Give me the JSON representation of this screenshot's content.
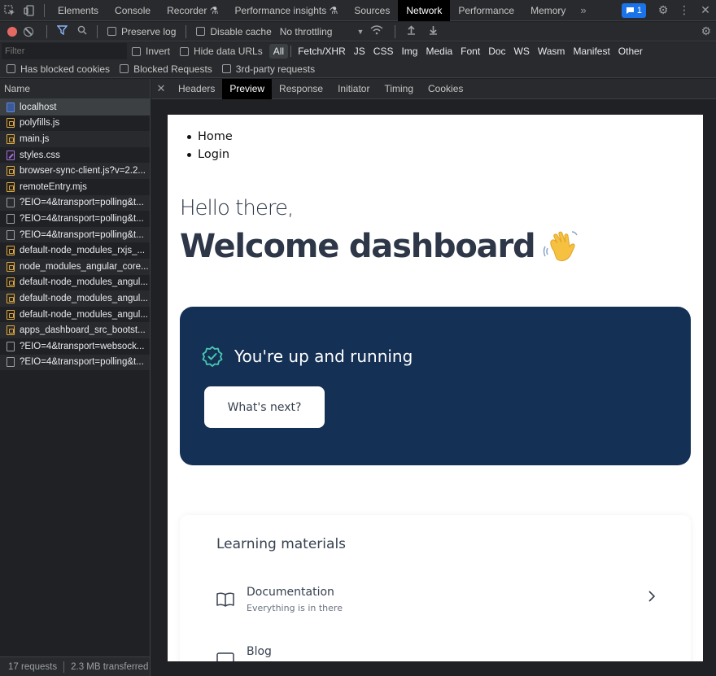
{
  "devtools": {
    "tabs": [
      {
        "label": "Elements"
      },
      {
        "label": "Console"
      },
      {
        "label": "Recorder ⚗"
      },
      {
        "label": "Performance insights ⚗"
      },
      {
        "label": "Sources"
      },
      {
        "label": "Network"
      },
      {
        "label": "Performance"
      },
      {
        "label": "Memory"
      }
    ],
    "more_label": "»",
    "issues_count": "1"
  },
  "toolbar": {
    "preserve_log": "Preserve log",
    "disable_cache": "Disable cache",
    "throttling": "No throttling"
  },
  "filter": {
    "placeholder": "Filter",
    "invert": "Invert",
    "hide_data_urls": "Hide data URLs",
    "types": [
      "All",
      "Fetch/XHR",
      "JS",
      "CSS",
      "Img",
      "Media",
      "Font",
      "Doc",
      "WS",
      "Wasm",
      "Manifest",
      "Other"
    ]
  },
  "blocked": {
    "has_blocked_cookies": "Has blocked cookies",
    "blocked_requests": "Blocked Requests",
    "third_party": "3rd-party requests"
  },
  "requests": {
    "header": "Name",
    "items": [
      {
        "name": "localhost",
        "type": "doc"
      },
      {
        "name": "polyfills.js",
        "type": "js"
      },
      {
        "name": "main.js",
        "type": "js"
      },
      {
        "name": "styles.css",
        "type": "css"
      },
      {
        "name": "browser-sync-client.js?v=2.2...",
        "type": "js"
      },
      {
        "name": "remoteEntry.mjs",
        "type": "js"
      },
      {
        "name": "?EIO=4&transport=polling&t...",
        "type": "blank"
      },
      {
        "name": "?EIO=4&transport=polling&t...",
        "type": "blank"
      },
      {
        "name": "?EIO=4&transport=polling&t...",
        "type": "blank"
      },
      {
        "name": "default-node_modules_rxjs_...",
        "type": "js"
      },
      {
        "name": "node_modules_angular_core...",
        "type": "js"
      },
      {
        "name": "default-node_modules_angul...",
        "type": "js"
      },
      {
        "name": "default-node_modules_angul...",
        "type": "js"
      },
      {
        "name": "default-node_modules_angul...",
        "type": "js"
      },
      {
        "name": "apps_dashboard_src_bootst...",
        "type": "js"
      },
      {
        "name": "?EIO=4&transport=websock...",
        "type": "blank"
      },
      {
        "name": "?EIO=4&transport=polling&t...",
        "type": "blank"
      }
    ]
  },
  "status": {
    "requests": "17 requests",
    "transferred": "2.3 MB transferred"
  },
  "detail_tabs": [
    "Headers",
    "Preview",
    "Response",
    "Initiator",
    "Timing",
    "Cookies"
  ],
  "preview": {
    "nav": [
      "Home",
      "Login"
    ],
    "hello": "Hello there,",
    "welcome": "Welcome dashboard",
    "hero_title": "You're up and running",
    "hero_button": "What's next?",
    "learning_title": "Learning materials",
    "items": [
      {
        "title": "Documentation",
        "subtitle": "Everything is in there"
      },
      {
        "title": "Blog",
        "subtitle": ""
      }
    ]
  },
  "colors": {
    "hero_bg": "#143055",
    "accent_check": "#48c9b0",
    "active_tab": "#000000",
    "record": "#e46962"
  }
}
